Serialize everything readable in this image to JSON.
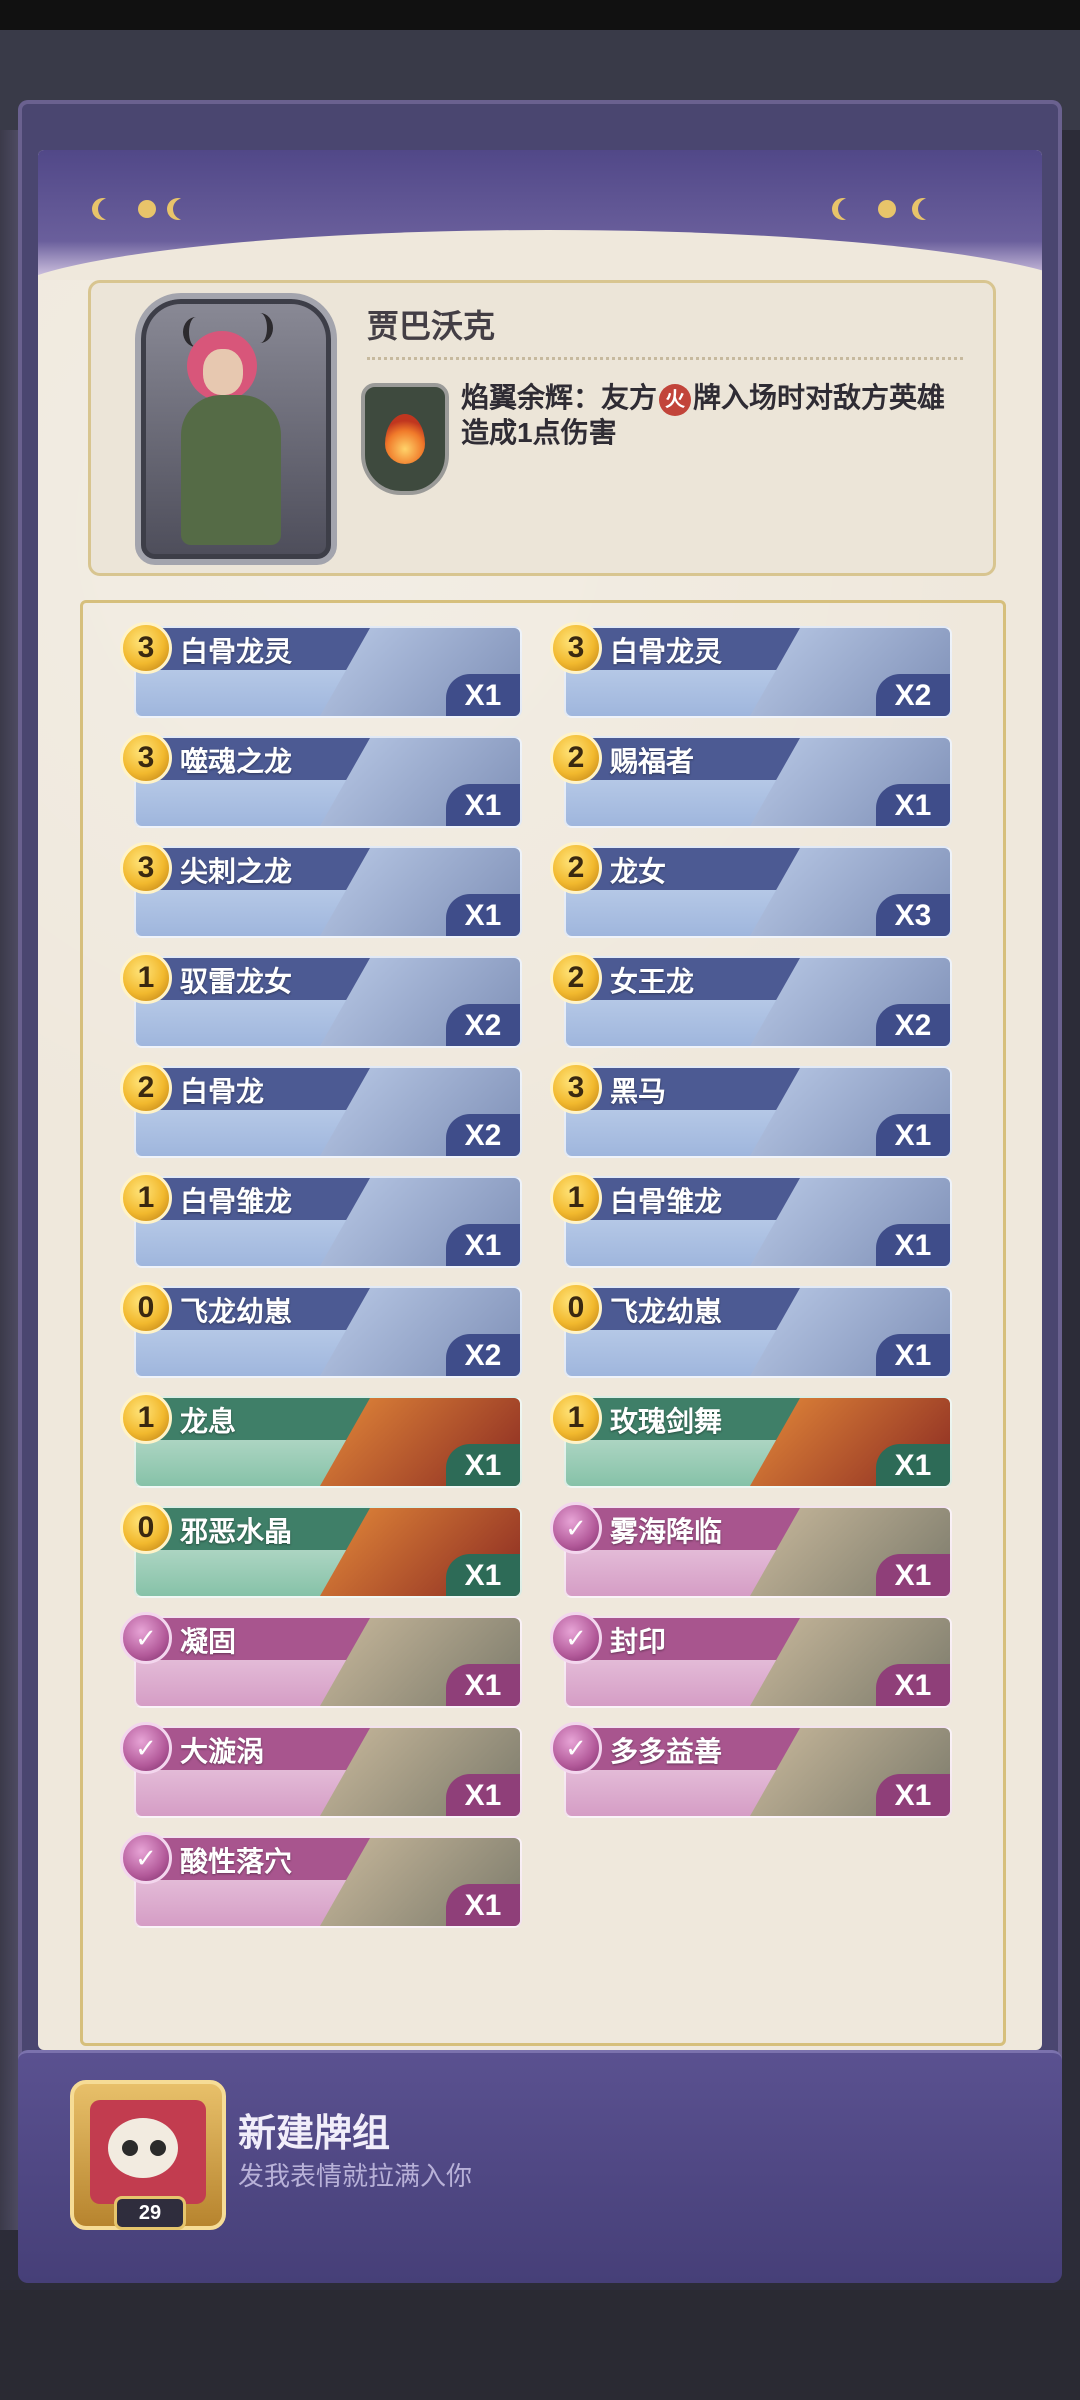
{
  "hero": {
    "name": "贾巴沃克",
    "skill_name": "焰翼余辉",
    "skill_text_before": "焰翼余辉：友方",
    "fire_chip": "火",
    "skill_text_after": "牌入场时对敌方英雄造成1点伤害"
  },
  "cards": [
    {
      "cost": "3",
      "name": "白骨龙灵",
      "count": "X1",
      "theme": "blue",
      "kind": "unit"
    },
    {
      "cost": "3",
      "name": "白骨龙灵",
      "count": "X2",
      "theme": "blue",
      "kind": "unit"
    },
    {
      "cost": "3",
      "name": "噬魂之龙",
      "count": "X1",
      "theme": "blue",
      "kind": "unit"
    },
    {
      "cost": "2",
      "name": "赐福者",
      "count": "X1",
      "theme": "blue",
      "kind": "unit"
    },
    {
      "cost": "3",
      "name": "尖刺之龙",
      "count": "X1",
      "theme": "blue",
      "kind": "unit"
    },
    {
      "cost": "2",
      "name": "龙女",
      "count": "X3",
      "theme": "blue",
      "kind": "unit"
    },
    {
      "cost": "1",
      "name": "驭雷龙女",
      "count": "X2",
      "theme": "blue",
      "kind": "unit"
    },
    {
      "cost": "2",
      "name": "女王龙",
      "count": "X2",
      "theme": "blue",
      "kind": "unit"
    },
    {
      "cost": "2",
      "name": "白骨龙",
      "count": "X2",
      "theme": "blue",
      "kind": "unit"
    },
    {
      "cost": "3",
      "name": "黑马",
      "count": "X1",
      "theme": "blue",
      "kind": "unit"
    },
    {
      "cost": "1",
      "name": "白骨雏龙",
      "count": "X1",
      "theme": "blue",
      "kind": "unit"
    },
    {
      "cost": "1",
      "name": "白骨雏龙",
      "count": "X1",
      "theme": "blue",
      "kind": "unit"
    },
    {
      "cost": "0",
      "name": "飞龙幼崽",
      "count": "X2",
      "theme": "blue",
      "kind": "unit"
    },
    {
      "cost": "0",
      "name": "飞龙幼崽",
      "count": "X1",
      "theme": "blue",
      "kind": "unit"
    },
    {
      "cost": "1",
      "name": "龙息",
      "count": "X1",
      "theme": "green",
      "kind": "unit"
    },
    {
      "cost": "1",
      "name": "玫瑰剑舞",
      "count": "X1",
      "theme": "green",
      "kind": "unit"
    },
    {
      "cost": "0",
      "name": "邪恶水晶",
      "count": "X1",
      "theme": "green",
      "kind": "unit"
    },
    {
      "cost": "✓",
      "name": "雾海降临",
      "count": "X1",
      "theme": "pink",
      "kind": "spell"
    },
    {
      "cost": "✓",
      "name": "凝固",
      "count": "X1",
      "theme": "pink",
      "kind": "spell"
    },
    {
      "cost": "✓",
      "name": "封印",
      "count": "X1",
      "theme": "pink",
      "kind": "spell"
    },
    {
      "cost": "✓",
      "name": "大漩涡",
      "count": "X1",
      "theme": "pink",
      "kind": "spell"
    },
    {
      "cost": "✓",
      "name": "多多益善",
      "count": "X1",
      "theme": "pink",
      "kind": "spell"
    },
    {
      "cost": "✓",
      "name": "酸性落穴",
      "count": "X1",
      "theme": "pink",
      "kind": "spell"
    }
  ],
  "deck": {
    "title": "新建牌组",
    "subtitle": "发我表情就拉满入你",
    "level": "29"
  },
  "colors": {
    "frame_purple": "#4a4670",
    "paper": "#efe8dc",
    "gold": "#d6bf7c",
    "unit_blue": "#4c5a93",
    "unit_green": "#3f7f68",
    "spell_pink": "#a8558e"
  }
}
